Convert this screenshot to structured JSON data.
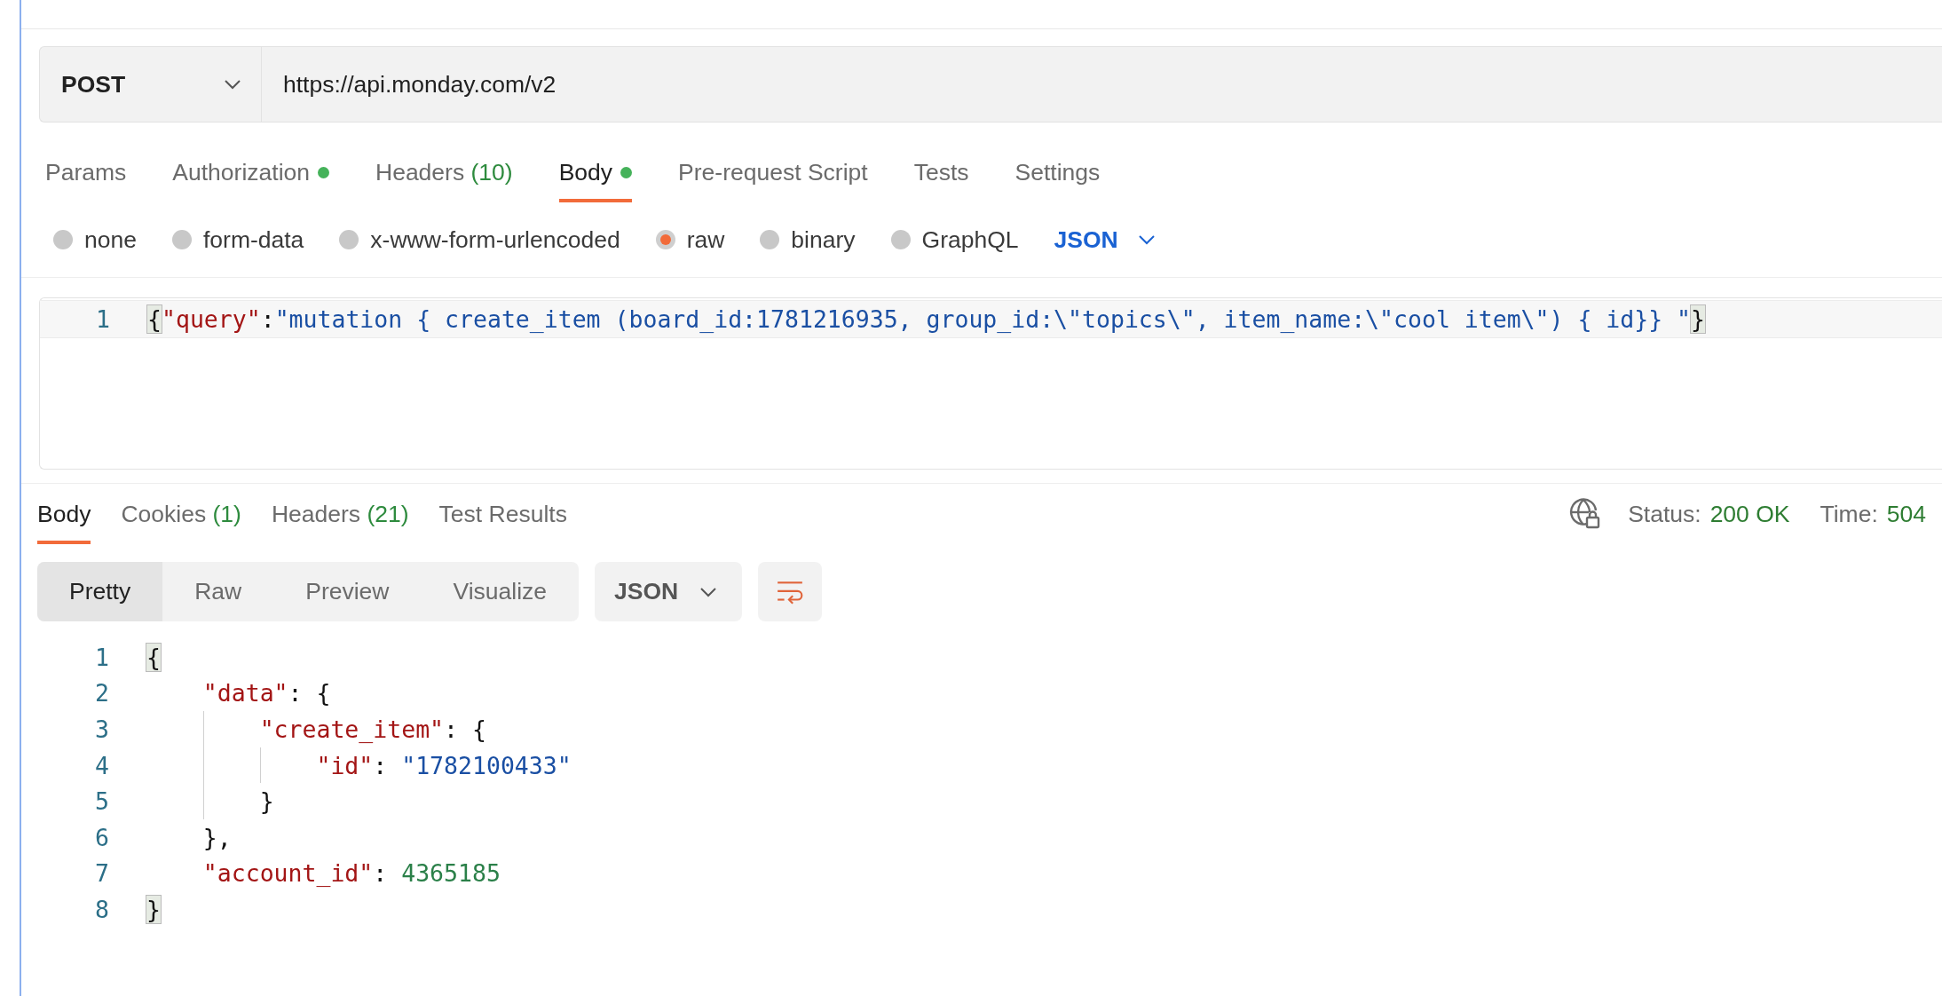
{
  "request": {
    "method": "POST",
    "url": "https://api.monday.com/v2"
  },
  "request_tabs": [
    {
      "label": "Params",
      "selected": false,
      "indicator": false
    },
    {
      "label": "Authorization",
      "selected": false,
      "indicator": true
    },
    {
      "label": "Headers",
      "count": "(10)",
      "selected": false,
      "indicator": false
    },
    {
      "label": "Body",
      "selected": true,
      "indicator": true
    },
    {
      "label": "Pre-request Script",
      "selected": false,
      "indicator": false
    },
    {
      "label": "Tests",
      "selected": false,
      "indicator": false
    },
    {
      "label": "Settings",
      "selected": false,
      "indicator": false
    }
  ],
  "body_types": [
    {
      "label": "none",
      "selected": false
    },
    {
      "label": "form-data",
      "selected": false
    },
    {
      "label": "x-www-form-urlencoded",
      "selected": false
    },
    {
      "label": "raw",
      "selected": true
    },
    {
      "label": "binary",
      "selected": false
    },
    {
      "label": "GraphQL",
      "selected": false
    }
  ],
  "body_language": "JSON",
  "request_body": [
    {
      "number": "1",
      "active": true,
      "tokens": [
        {
          "kind": "punct",
          "text": "{",
          "match": true
        },
        {
          "kind": "key",
          "text": "\"query\""
        },
        {
          "kind": "punct",
          "text": ":"
        },
        {
          "kind": "string",
          "text": "\"mutation { create_item (board_id:1781216935, group_id:\\\"topics\\\", item_name:\\\"cool item\\\") { id}} \""
        },
        {
          "kind": "punct",
          "text": "}",
          "match": true
        }
      ]
    }
  ],
  "response_tabs": [
    {
      "label": "Body",
      "selected": true
    },
    {
      "label": "Cookies",
      "count": "(1)",
      "selected": false
    },
    {
      "label": "Headers",
      "count": "(21)",
      "selected": false
    },
    {
      "label": "Test Results",
      "selected": false
    }
  ],
  "response_status": {
    "status_label": "Status:",
    "status": "200 OK",
    "time_label": "Time:",
    "time": "504"
  },
  "view_modes": [
    {
      "label": "Pretty",
      "selected": true
    },
    {
      "label": "Raw",
      "selected": false
    },
    {
      "label": "Preview",
      "selected": false
    },
    {
      "label": "Visualize",
      "selected": false
    }
  ],
  "response_format": "JSON",
  "response_body": [
    {
      "number": "1",
      "tokens": [
        {
          "kind": "punct",
          "text": "{",
          "match": true
        }
      ]
    },
    {
      "number": "2",
      "tokens": [
        {
          "kind": "key",
          "text": "    \"data\""
        },
        {
          "kind": "punct",
          "text": ": {"
        }
      ]
    },
    {
      "number": "3",
      "tokens": [
        {
          "kind": "key",
          "text": "        \"create_item\""
        },
        {
          "kind": "punct",
          "text": ": {"
        }
      ]
    },
    {
      "number": "4",
      "tokens": [
        {
          "kind": "key",
          "text": "            \"id\""
        },
        {
          "kind": "punct",
          "text": ": "
        },
        {
          "kind": "string",
          "text": "\"1782100433\""
        }
      ]
    },
    {
      "number": "5",
      "tokens": [
        {
          "kind": "punct",
          "text": "        }"
        }
      ]
    },
    {
      "number": "6",
      "tokens": [
        {
          "kind": "punct",
          "text": "    },"
        }
      ]
    },
    {
      "number": "7",
      "tokens": [
        {
          "kind": "key",
          "text": "    \"account_id\""
        },
        {
          "kind": "punct",
          "text": ": "
        },
        {
          "kind": "number",
          "text": "4365185"
        }
      ]
    },
    {
      "number": "8",
      "tokens": [
        {
          "kind": "punct",
          "text": "}",
          "match": true
        }
      ]
    }
  ]
}
